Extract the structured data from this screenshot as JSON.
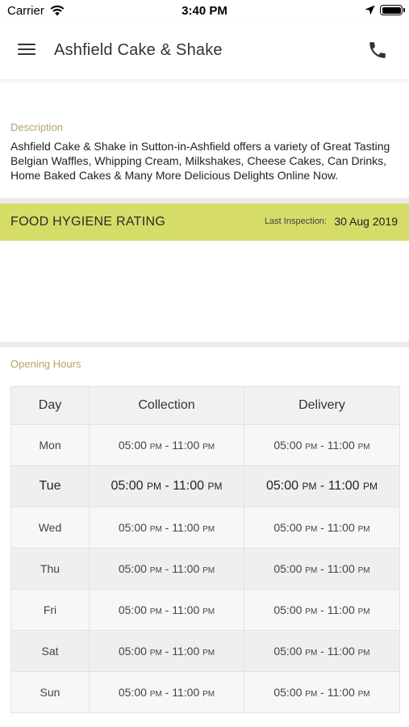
{
  "status_bar": {
    "carrier": "Carrier",
    "time": "3:40 PM"
  },
  "app_bar": {
    "title": "Ashfield Cake & Shake"
  },
  "description": {
    "label": "Description",
    "text": "Ashfield Cake & Shake in Sutton-in-Ashfield offers a variety of Great Tasting Belgian Waffles, Whipping Cream, Milkshakes, Cheese Cakes, Can Drinks, Home Baked Cakes & Many More Delicious Delights Online Now."
  },
  "hygiene": {
    "title": "FOOD HYGIENE RATING",
    "last_inspection_label": "Last Inspection:",
    "last_inspection_date": "30 Aug 2019",
    "bar_color": "#d5dc67"
  },
  "opening_hours": {
    "label": "Opening Hours",
    "headers": [
      "Day",
      "Collection",
      "Delivery"
    ],
    "rows": [
      {
        "day": "Mon",
        "collection": {
          "start": "05:00",
          "start_ampm": "PM",
          "end": "11:00",
          "end_ampm": "PM"
        },
        "delivery": {
          "start": "05:00",
          "start_ampm": "PM",
          "end": "11:00",
          "end_ampm": "PM"
        },
        "today": false
      },
      {
        "day": "Tue",
        "collection": {
          "start": "05:00",
          "start_ampm": "PM",
          "end": "11:00",
          "end_ampm": "PM"
        },
        "delivery": {
          "start": "05:00",
          "start_ampm": "PM",
          "end": "11:00",
          "end_ampm": "PM"
        },
        "today": true
      },
      {
        "day": "Wed",
        "collection": {
          "start": "05:00",
          "start_ampm": "PM",
          "end": "11:00",
          "end_ampm": "PM"
        },
        "delivery": {
          "start": "05:00",
          "start_ampm": "PM",
          "end": "11:00",
          "end_ampm": "PM"
        },
        "today": false
      },
      {
        "day": "Thu",
        "collection": {
          "start": "05:00",
          "start_ampm": "PM",
          "end": "11:00",
          "end_ampm": "PM"
        },
        "delivery": {
          "start": "05:00",
          "start_ampm": "PM",
          "end": "11:00",
          "end_ampm": "PM"
        },
        "today": false
      },
      {
        "day": "Fri",
        "collection": {
          "start": "05:00",
          "start_ampm": "PM",
          "end": "11:00",
          "end_ampm": "PM"
        },
        "delivery": {
          "start": "05:00",
          "start_ampm": "PM",
          "end": "11:00",
          "end_ampm": "PM"
        },
        "today": false
      },
      {
        "day": "Sat",
        "collection": {
          "start": "05:00",
          "start_ampm": "PM",
          "end": "11:00",
          "end_ampm": "PM"
        },
        "delivery": {
          "start": "05:00",
          "start_ampm": "PM",
          "end": "11:00",
          "end_ampm": "PM"
        },
        "today": false
      },
      {
        "day": "Sun",
        "collection": {
          "start": "05:00",
          "start_ampm": "PM",
          "end": "11:00",
          "end_ampm": "PM"
        },
        "delivery": {
          "start": "05:00",
          "start_ampm": "PM",
          "end": "11:00",
          "end_ampm": "PM"
        },
        "today": false
      }
    ]
  },
  "icons": {
    "wifi": "wifi-icon",
    "location": "location-arrow-icon",
    "battery": "battery-icon",
    "menu": "hamburger-menu-icon",
    "phone": "phone-icon"
  }
}
